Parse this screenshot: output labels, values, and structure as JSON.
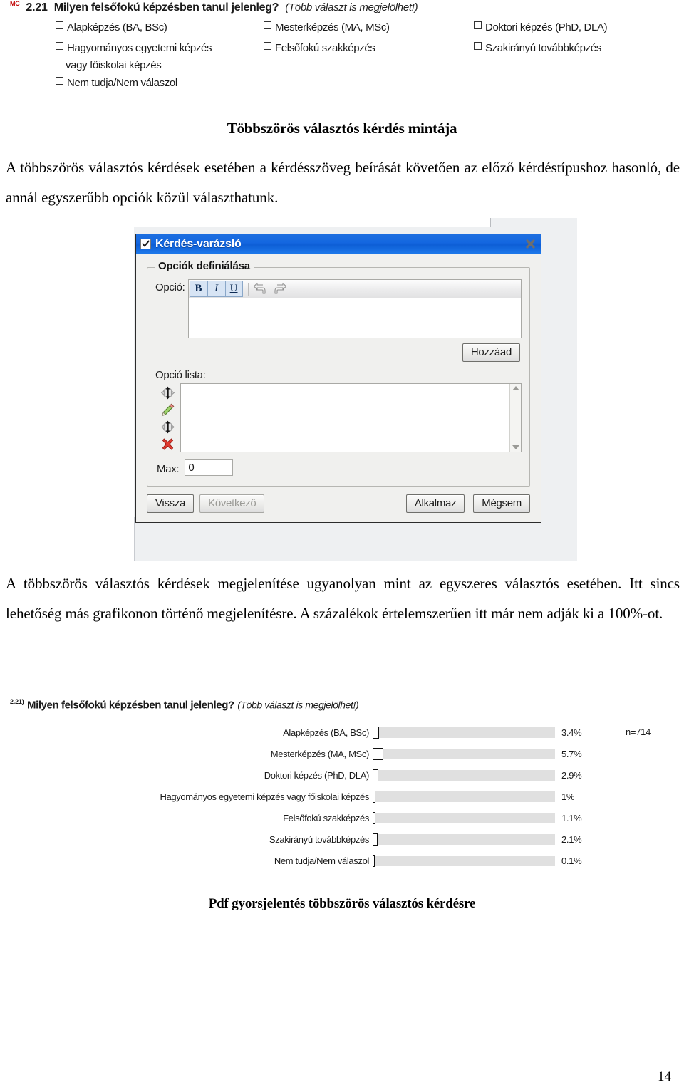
{
  "scanned_question": {
    "mc_mark": "MC",
    "number": "2.21",
    "question": "Milyen felsőfokú képzésben tanul jelenleg?",
    "hint": "(Több választ is megjelölhet!)",
    "options": [
      "Alapképzés (BA, BSc)",
      "Mesterképzés (MA, MSc)",
      "Doktori képzés (PhD, DLA)",
      "Hagyományos egyetemi képzés",
      "Felsőfokú szakképzés",
      "Szakirányú továbbképzés",
      "Nem tudja/Nem válaszol"
    ],
    "option_continuation": "vagy főiskolai képzés"
  },
  "document": {
    "heading": "Többszörös választós kérdés mintája",
    "intro_paragraph": "A többszörös választós kérdések esetében a kérdésszöveg beírását követően az előző kérdéstípushoz hasonló, de annál egyszerűbb opciók közül választhatunk.",
    "outro_paragraph": "A többszörös választós kérdések megjelenítése ugyanolyan mint az egyszeres választós esetében. Itt sincs lehetőség más grafikonon történő megjelenítésre. A százalékok értelemszerűen itt már nem adják ki a 100%-ot.",
    "figure_caption": "Pdf gyorsjelentés többszörös választós kérdésre",
    "page_number": "14"
  },
  "dialog": {
    "title": "Kérdés-varázsló",
    "title_icon": "checked-checkbox-icon",
    "close_icon": "close-icon",
    "fieldset_legend": "Opciók definiálása",
    "option_label": "Opció:",
    "option_value": "",
    "toolbar": {
      "bold": "B",
      "italic": "I",
      "underline": "U",
      "undo_icon": "undo-arrow-icon",
      "redo_icon": "redo-arrow-icon"
    },
    "add_button": "Hozzáad",
    "list_label": "Opció lista:",
    "list_items": [],
    "list_tools": [
      "move-up-icon",
      "edit-pencil-icon",
      "move-down-icon",
      "delete-icon"
    ],
    "max_label": "Max:",
    "max_value": "0",
    "buttons": {
      "back": "Vissza",
      "next": "Következő",
      "apply": "Alkalmaz",
      "cancel": "Mégsem"
    }
  },
  "chart_data": {
    "type": "bar",
    "orientation": "horizontal",
    "question_number": "2.21)",
    "title": "Milyen felsőfokú képzésben tanul jelenleg?",
    "subtitle": "(Több választ is megjelölhet!)",
    "sample_size_label": "n=714",
    "xlabel": "",
    "ylabel": "",
    "xlim": [
      0,
      100
    ],
    "grid": false,
    "legend": "none",
    "value_suffix": "%",
    "categories": [
      "Alapképzés (BA, BSc)",
      "Mesterképzés (MA, MSc)",
      "Doktori képzés (PhD, DLA)",
      "Hagyományos egyetemi képzés vagy főiskolai képzés",
      "Felsőfokú szakképzés",
      "Szakirányú továbbképzés",
      "Nem tudja/Nem válaszol"
    ],
    "values": [
      3.4,
      5.7,
      2.9,
      1,
      1.1,
      2.1,
      0.1
    ],
    "value_labels": [
      "3.4%",
      "5.7%",
      "2.9%",
      "1%",
      "1.1%",
      "2.1%",
      "0.1%"
    ]
  }
}
